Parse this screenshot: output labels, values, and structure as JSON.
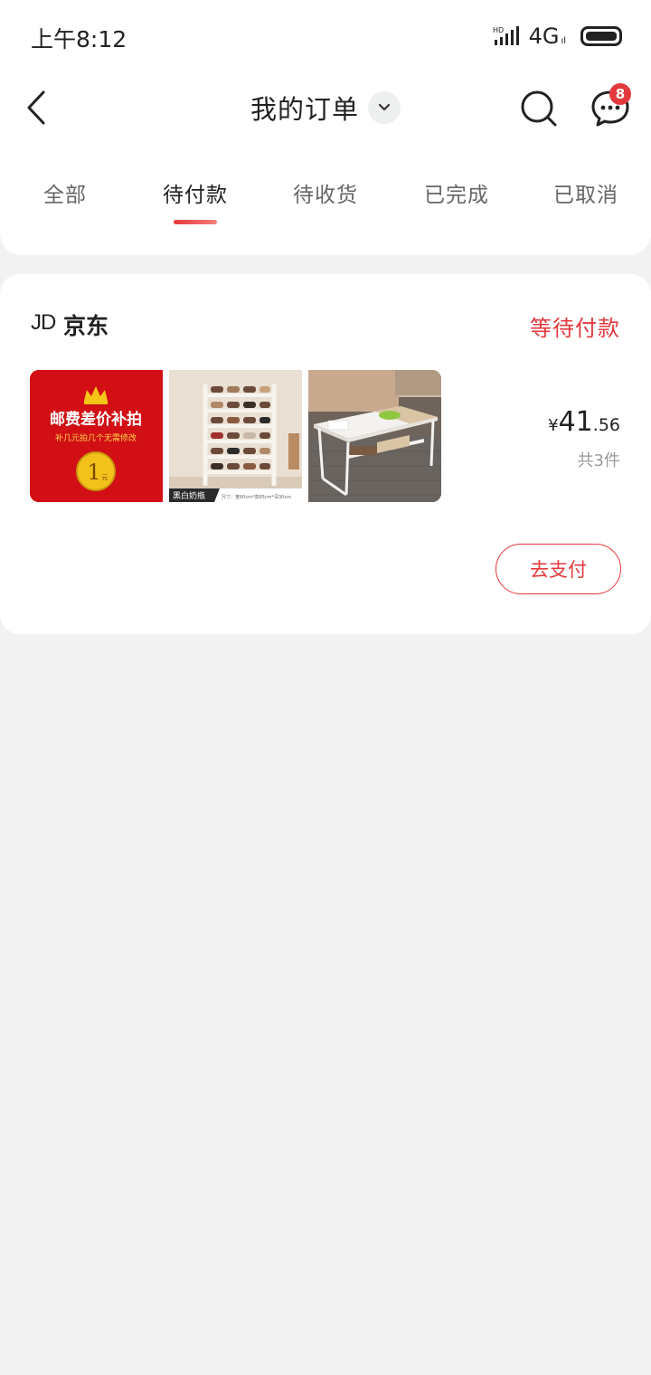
{
  "status_bar": {
    "time": "上午8:12",
    "hd": "HD",
    "network": "4G",
    "network_sub": "ıl"
  },
  "nav": {
    "title": "我的订单",
    "badge_count": "8",
    "icons": [
      "back-arrow-icon",
      "chevron-down-icon",
      "search-icon",
      "message-icon"
    ]
  },
  "tabs": [
    {
      "label": "全部",
      "active": false
    },
    {
      "label": "待付款",
      "active": true
    },
    {
      "label": "待收货",
      "active": false
    },
    {
      "label": "已完成",
      "active": false
    },
    {
      "label": "已取消",
      "active": false
    }
  ],
  "order": {
    "shop_logo": "JD",
    "shop_name": "京东",
    "status": "等待付款",
    "products": [
      {
        "title": "邮费差价补拍",
        "subtitle": "补几元拍几个无需修改",
        "coin": "1",
        "coin_unit": "元"
      },
      {
        "tag": "黑白奶瓶",
        "spec": "尺寸：宽60cm*高85cm*深30cm"
      },
      {}
    ],
    "price_currency": "¥",
    "price_int": "41",
    "price_dec": ".56",
    "count_text": "共3件",
    "pay_button": "去支付"
  },
  "colors": {
    "accent": "#e4393c",
    "background": "#f2f2f2"
  }
}
